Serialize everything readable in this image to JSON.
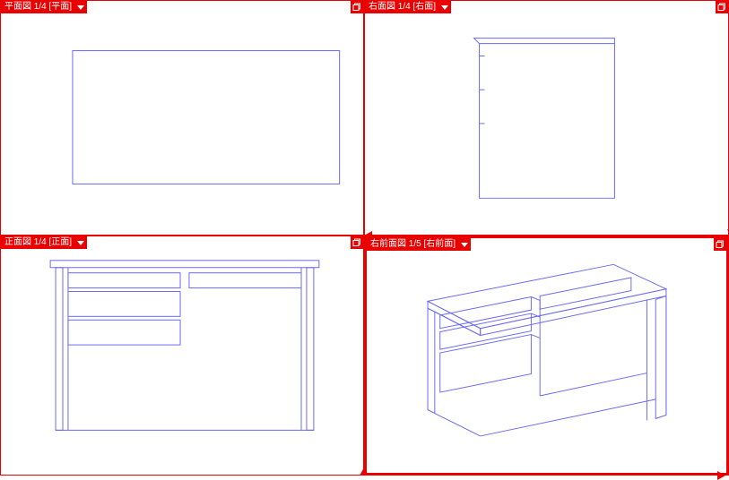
{
  "viewports": {
    "tl": {
      "label": "平面図 1/4 [平面]"
    },
    "tr": {
      "label": "右面図 1/4 [右面]"
    },
    "bl": {
      "label": "正面図 1/4 [正面]"
    },
    "br": {
      "label": "右前面図 1/5 [右前面]"
    }
  },
  "icons": {
    "dropdown": "chevron-down-icon",
    "restore": "restore-window-icon"
  },
  "colors": {
    "accent": "#e90000",
    "wireframe": "#6a6af0"
  },
  "active_viewport": "br"
}
